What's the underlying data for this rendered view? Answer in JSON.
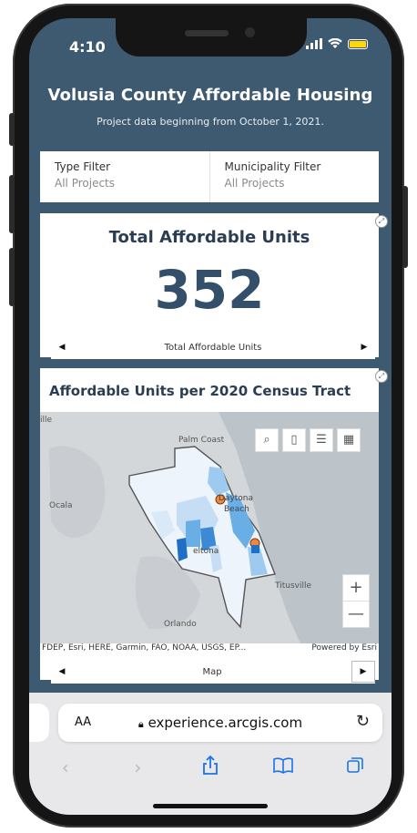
{
  "status": {
    "time": "4:10"
  },
  "header": {
    "title": "Volusia County Affordable Housing",
    "subtitle": "Project data beginning from October 1, 2021."
  },
  "filters": [
    {
      "label": "Type Filter",
      "value": "All Projects"
    },
    {
      "label": "Municipality Filter",
      "value": "All Projects"
    }
  ],
  "units_card": {
    "title": "Total Affordable Units",
    "value": "352",
    "nav_label": "Total Affordable Units"
  },
  "map_card": {
    "title": "Affordable Units per 2020 Census Tract",
    "places": {
      "palm_coast": "Palm Coast",
      "ocala": "Ocala",
      "daytona": "Daytona",
      "beach": "Beach",
      "deltona": "eltona",
      "titusville": "Titusville",
      "orlando": "Orlando",
      "ille": "ille"
    },
    "attribution": "FDEP, Esri, HERE, Garmin, FAO, NOAA, USGS, EP...",
    "powered_by": "Powered by Esri",
    "nav_label": "Map",
    "zoom_in": "+",
    "zoom_out": "—"
  },
  "browser": {
    "aa": "AA",
    "url": "experience.arcgis.com"
  },
  "icons": {
    "search": "search-icon",
    "bookmark": "bookmark-icon",
    "legend": "legend-list-icon",
    "basemap": "basemap-gallery-icon",
    "lock": "lock-icon",
    "reload": "reload-icon",
    "back": "back-icon",
    "forward": "forward-icon",
    "share": "share-icon",
    "bookmarks": "book-icon",
    "tabs": "tabs-icon"
  },
  "colors": {
    "header_bg": "#3e5a70",
    "value_text": "#344f69",
    "tract_light": "#c6def5",
    "tract_mid": "#6aaee6",
    "tract_dark": "#1f6fc4",
    "project_marker": "#f0893a",
    "link_blue": "#1a73e8"
  }
}
